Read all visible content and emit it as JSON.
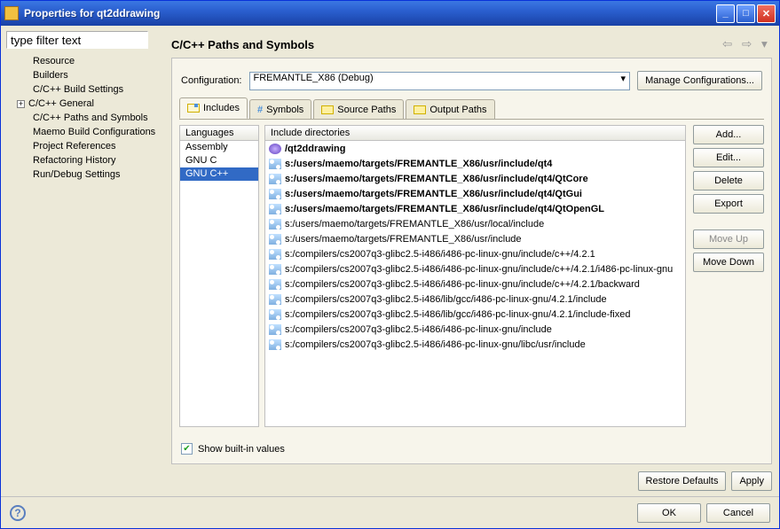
{
  "window": {
    "title": "Properties for qt2ddrawing"
  },
  "filter": {
    "placeholder": "type filter text"
  },
  "tree": {
    "items": [
      {
        "label": "Resource",
        "expandable": false
      },
      {
        "label": "Builders",
        "expandable": false
      },
      {
        "label": "C/C++ Build Settings",
        "expandable": false
      },
      {
        "label": "C/C++ General",
        "expandable": true
      },
      {
        "label": "C/C++ Paths and Symbols",
        "expandable": false,
        "selected": true
      },
      {
        "label": "Maemo Build Configurations",
        "expandable": false
      },
      {
        "label": "Project References",
        "expandable": false
      },
      {
        "label": "Refactoring History",
        "expandable": false
      },
      {
        "label": "Run/Debug Settings",
        "expandable": false
      }
    ]
  },
  "page": {
    "heading": "C/C++ Paths and Symbols",
    "config_label": "Configuration:",
    "config_value": "FREMANTLE_X86 (Debug)",
    "manage_btn": "Manage Configurations...",
    "tabs": [
      {
        "label": "Includes",
        "active": true
      },
      {
        "label": "Symbols",
        "active": false
      },
      {
        "label": "Source Paths",
        "active": false
      },
      {
        "label": "Output Paths",
        "active": false
      }
    ],
    "lang_header": "Languages",
    "languages": [
      {
        "label": "Assembly",
        "selected": false
      },
      {
        "label": "GNU C",
        "selected": false
      },
      {
        "label": "GNU C++",
        "selected": true
      }
    ],
    "dir_header": "Include directories",
    "dirs": [
      {
        "label": "/qt2ddrawing",
        "type": "project",
        "bold": true
      },
      {
        "label": "s:/users/maemo/targets/FREMANTLE_X86/usr/include/qt4",
        "type": "path",
        "bold": true
      },
      {
        "label": "s:/users/maemo/targets/FREMANTLE_X86/usr/include/qt4/QtCore",
        "type": "path",
        "bold": true
      },
      {
        "label": "s:/users/maemo/targets/FREMANTLE_X86/usr/include/qt4/QtGui",
        "type": "path",
        "bold": true
      },
      {
        "label": "s:/users/maemo/targets/FREMANTLE_X86/usr/include/qt4/QtOpenGL",
        "type": "path",
        "bold": true
      },
      {
        "label": "s:/users/maemo/targets/FREMANTLE_X86/usr/local/include",
        "type": "path",
        "bold": false
      },
      {
        "label": "s:/users/maemo/targets/FREMANTLE_X86/usr/include",
        "type": "path",
        "bold": false
      },
      {
        "label": "s:/compilers/cs2007q3-glibc2.5-i486/i486-pc-linux-gnu/include/c++/4.2.1",
        "type": "path",
        "bold": false
      },
      {
        "label": "s:/compilers/cs2007q3-glibc2.5-i486/i486-pc-linux-gnu/include/c++/4.2.1/i486-pc-linux-gnu",
        "type": "path",
        "bold": false
      },
      {
        "label": "s:/compilers/cs2007q3-glibc2.5-i486/i486-pc-linux-gnu/include/c++/4.2.1/backward",
        "type": "path",
        "bold": false
      },
      {
        "label": "s:/compilers/cs2007q3-glibc2.5-i486/lib/gcc/i486-pc-linux-gnu/4.2.1/include",
        "type": "path",
        "bold": false
      },
      {
        "label": "s:/compilers/cs2007q3-glibc2.5-i486/lib/gcc/i486-pc-linux-gnu/4.2.1/include-fixed",
        "type": "path",
        "bold": false
      },
      {
        "label": "s:/compilers/cs2007q3-glibc2.5-i486/i486-pc-linux-gnu/include",
        "type": "path",
        "bold": false
      },
      {
        "label": "s:/compilers/cs2007q3-glibc2.5-i486/i486-pc-linux-gnu/libc/usr/include",
        "type": "path",
        "bold": false
      }
    ],
    "btns": {
      "add": "Add...",
      "edit": "Edit...",
      "delete": "Delete",
      "export": "Export",
      "moveup": "Move Up",
      "movedown": "Move Down"
    },
    "show_builtin": "Show built-in values",
    "restore": "Restore Defaults",
    "apply": "Apply"
  },
  "footer": {
    "ok": "OK",
    "cancel": "Cancel"
  }
}
